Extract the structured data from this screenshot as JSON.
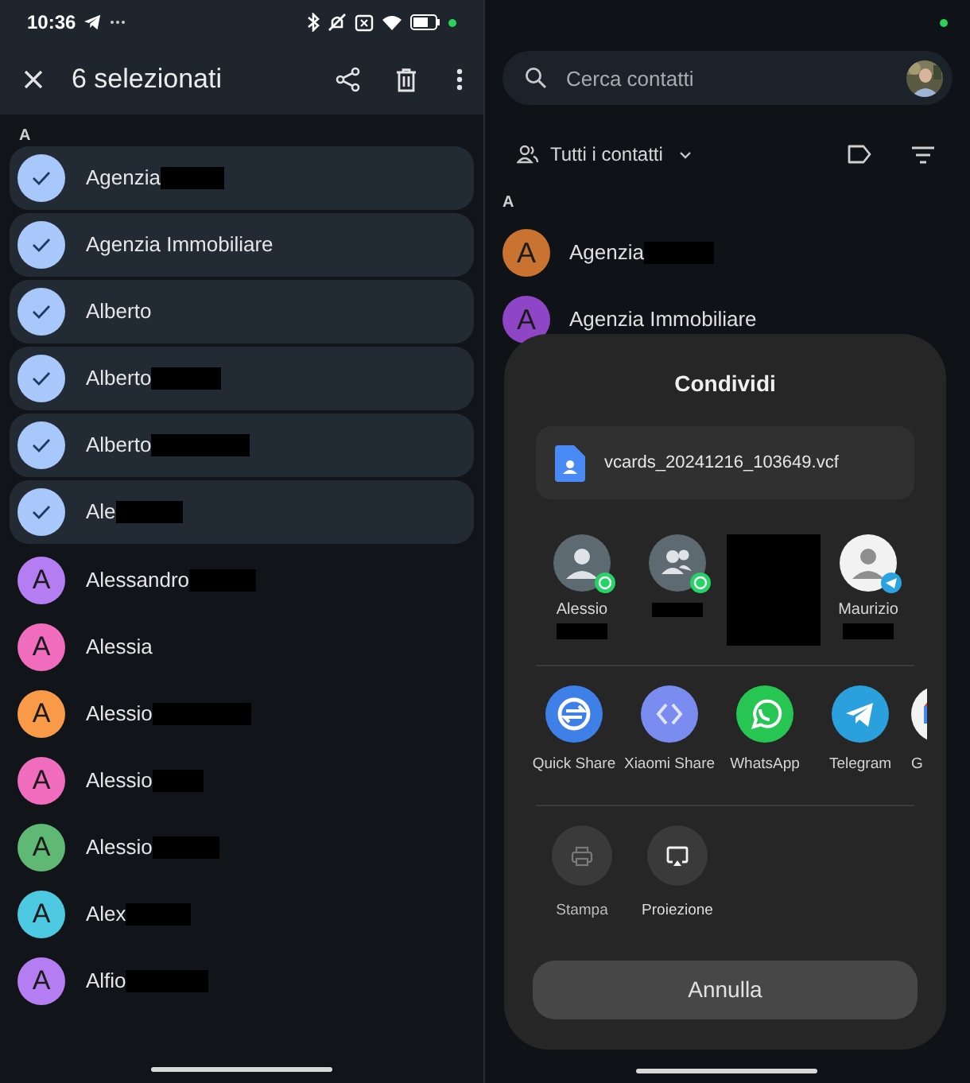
{
  "left": {
    "status_bar": {
      "time": "10:36"
    },
    "toolbar": {
      "title": "6 selezionati"
    },
    "section": "A",
    "contacts": [
      {
        "name": "Agenzia",
        "redacted": true,
        "selected": true,
        "color": "#a8c7fa"
      },
      {
        "name": "Agenzia Immobiliare",
        "redacted": false,
        "selected": true,
        "color": "#a8c7fa"
      },
      {
        "name": "Alberto",
        "redacted": false,
        "selected": true,
        "color": "#a8c7fa"
      },
      {
        "name": "Alberto",
        "redacted": true,
        "selected": true,
        "color": "#a8c7fa"
      },
      {
        "name": "Alberto",
        "redacted": true,
        "selected": true,
        "color": "#a8c7fa"
      },
      {
        "name": "Ale",
        "redacted": true,
        "selected": true,
        "color": "#a8c7fa"
      },
      {
        "initial": "A",
        "name": "Alessandro",
        "redacted": true,
        "selected": false,
        "color": "#b47ef2"
      },
      {
        "initial": "A",
        "name": "Alessia",
        "redacted": false,
        "selected": false,
        "color": "#f06cbc"
      },
      {
        "initial": "A",
        "name": "Alessio",
        "redacted": true,
        "selected": false,
        "color": "#f89a48"
      },
      {
        "initial": "A",
        "name": "Alessio",
        "redacted": true,
        "selected": false,
        "color": "#f06cbc"
      },
      {
        "initial": "A",
        "name": "Alessio",
        "redacted": true,
        "selected": false,
        "color": "#5fb873"
      },
      {
        "initial": "A",
        "name": "Alex",
        "redacted": true,
        "selected": false,
        "color": "#4ec9e2"
      },
      {
        "initial": "A",
        "name": "Alfio",
        "redacted": true,
        "selected": false,
        "color": "#b47ef2"
      }
    ]
  },
  "right": {
    "search": {
      "placeholder": "Cerca contatti"
    },
    "filter": {
      "label": "Tutti i contatti"
    },
    "section": "A",
    "contacts": [
      {
        "initial": "A",
        "name": "Agenzia",
        "redacted": true,
        "color": "#c8732f"
      },
      {
        "initial": "A",
        "name": "Agenzia Immobiliare",
        "redacted": false,
        "color": "#8e45c6"
      }
    ],
    "share_sheet": {
      "title": "Condividi",
      "file": "vcards_20241216_103649.vcf",
      "targets": [
        {
          "kind": "person",
          "name": "Alessio",
          "badge": {
            "kind": "whatsapp"
          },
          "redacted": true
        },
        {
          "kind": "group",
          "badge": {
            "kind": "whatsapp"
          },
          "redacted": true
        },
        {
          "kind": "hidden"
        },
        {
          "kind": "contact",
          "name": "Maurizio",
          "badge": {
            "kind": "telegram"
          },
          "redacted": true
        }
      ],
      "apps": [
        {
          "kind": "quickshare",
          "label": "Quick Share"
        },
        {
          "kind": "xiaomishare",
          "label": "Xiaomi Share"
        },
        {
          "kind": "whatsapp",
          "label": "WhatsApp"
        },
        {
          "kind": "telegram",
          "label": "Telegram"
        },
        {
          "kind": "gmail",
          "label": "G"
        }
      ],
      "actions": [
        {
          "kind": "print",
          "label": "Stampa",
          "disabled": true
        },
        {
          "kind": "cast",
          "label": "Proiezione",
          "disabled": false
        }
      ],
      "cancel": "Annulla"
    }
  }
}
